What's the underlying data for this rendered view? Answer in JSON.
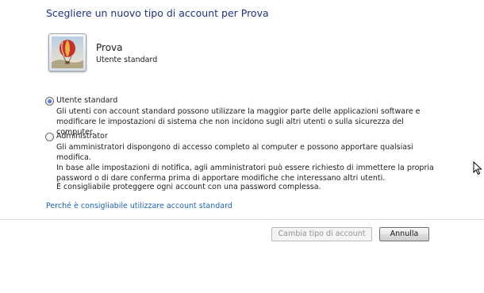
{
  "title": "Scegliere un nuovo tipo di account per Prova",
  "user": {
    "icon": "hot-air-balloon-picture",
    "name": "Prova",
    "type": "Utente standard"
  },
  "options": {
    "standard": {
      "label": "Utente standard",
      "checked": true,
      "description": "Gli utenti con account standard possono utilizzare la maggior parte delle applicazioni software e\nmodificare le impostazioni di sistema che non incidono sugli altri utenti o sulla sicurezza del computer."
    },
    "admin": {
      "label": "Administrator",
      "checked": false,
      "description": "Gli amministratori dispongono di accesso completo al computer e possono apportare qualsiasi modifica.\nIn base alle impostazioni di notifica, agli amministratori può essere richiesto di immettere la propria\npassword o di dare conferma prima di apportare modifiche che interessano altri utenti."
    }
  },
  "advice": "È consigliabile proteggere ogni account con una password complessa.",
  "link": "Perché è consigliabile utilizzare account standard",
  "buttons": {
    "change": "Cambia tipo di account",
    "cancel": "Annulla"
  },
  "colors": {
    "title": "#1e3287",
    "link": "#1d62b8"
  }
}
